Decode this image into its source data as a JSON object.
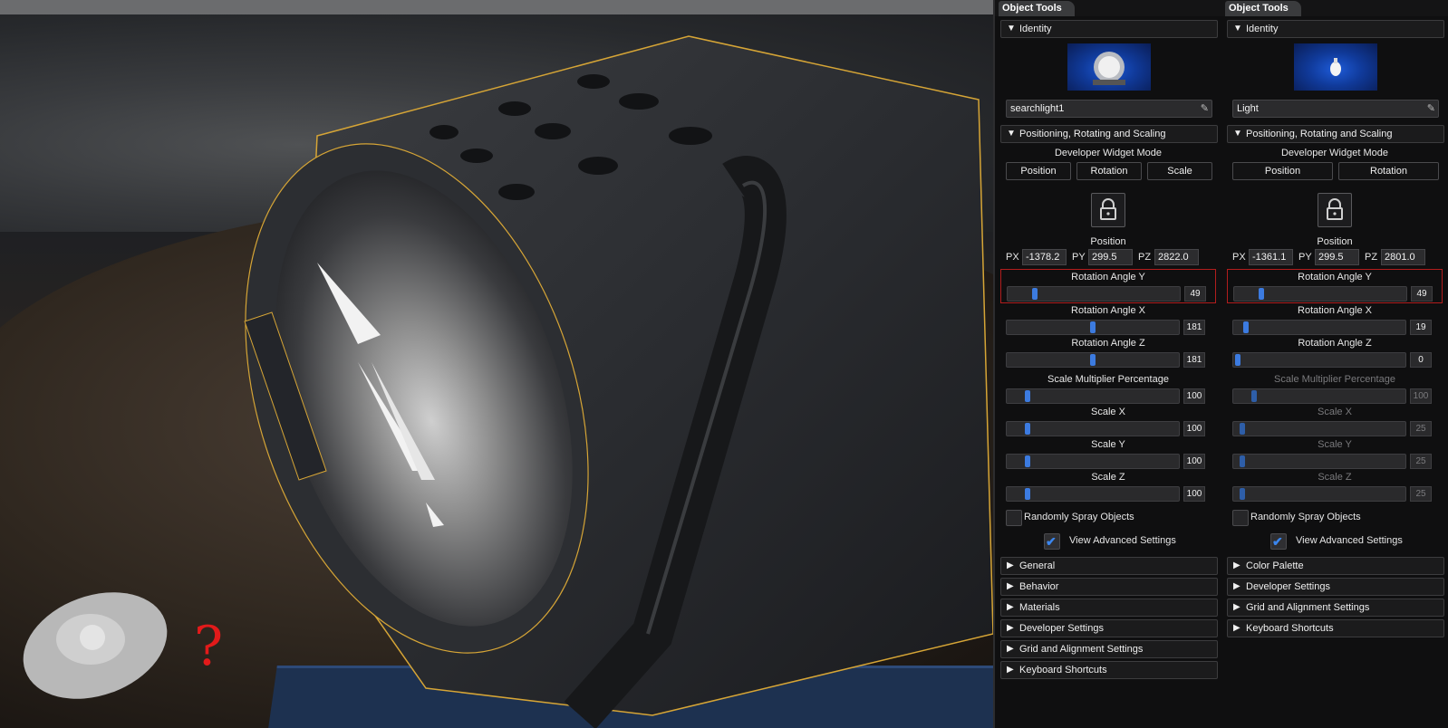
{
  "viewport": {
    "help_mark": "?"
  },
  "colors": {
    "accent": "#3c7be0",
    "highlight_border": "#b21d1d",
    "selection_outline": "#d6a536"
  },
  "panels": [
    {
      "tab": "Object Tools",
      "identity_header": "Identity",
      "thumbnail_icon": "searchlight-icon",
      "object_name": "searchlight1",
      "positioning_header": "Positioning, Rotating and Scaling",
      "widget_mode_label": "Developer Widget Mode",
      "mode_buttons": [
        "Position",
        "Rotation",
        "Scale"
      ],
      "position_label": "Position",
      "position": {
        "px_label": "PX",
        "px": "-1378.2",
        "py_label": "PY",
        "py": "299.5",
        "pz_label": "PZ",
        "pz": "2822.0"
      },
      "sliders": [
        {
          "label": "Rotation Angle Y",
          "value": "49",
          "level": 0.14,
          "highlight": true,
          "dim": false
        },
        {
          "label": "Rotation Angle X",
          "value": "181",
          "level": 0.5,
          "highlight": false,
          "dim": false
        },
        {
          "label": "Rotation Angle Z",
          "value": "181",
          "level": 0.5,
          "highlight": false,
          "dim": false
        },
        {
          "label": "Scale Multiplier Percentage",
          "value": "100",
          "level": 0.1,
          "highlight": false,
          "dim": false
        },
        {
          "label": "Scale X",
          "value": "100",
          "level": 0.1,
          "highlight": false,
          "dim": false
        },
        {
          "label": "Scale Y",
          "value": "100",
          "level": 0.1,
          "highlight": false,
          "dim": false
        },
        {
          "label": "Scale Z",
          "value": "100",
          "level": 0.1,
          "highlight": false,
          "dim": false
        }
      ],
      "checkboxes": [
        {
          "label": "Randomly Spray Objects",
          "checked": false
        },
        {
          "label": "View Advanced Settings",
          "checked": true
        }
      ],
      "collapsed_sections": [
        "General",
        "Behavior",
        "Materials",
        "Developer Settings",
        "Grid and Alignment Settings",
        "Keyboard Shortcuts"
      ]
    },
    {
      "tab": "Object Tools",
      "identity_header": "Identity",
      "thumbnail_icon": "lightbulb-icon",
      "object_name": "Light",
      "positioning_header": "Positioning, Rotating and Scaling",
      "widget_mode_label": "Developer Widget Mode",
      "mode_buttons": [
        "Position",
        "Rotation"
      ],
      "position_label": "Position",
      "position": {
        "px_label": "PX",
        "px": "-1361.1",
        "py_label": "PY",
        "py": "299.5",
        "pz_label": "PZ",
        "pz": "2801.0"
      },
      "sliders": [
        {
          "label": "Rotation Angle Y",
          "value": "49",
          "level": 0.14,
          "highlight": true,
          "dim": false
        },
        {
          "label": "Rotation Angle X",
          "value": "19",
          "level": 0.05,
          "highlight": false,
          "dim": false
        },
        {
          "label": "Rotation Angle Z",
          "value": "0",
          "level": 0.0,
          "highlight": false,
          "dim": false
        },
        {
          "label": "Scale Multiplier Percentage",
          "value": "100",
          "level": 0.1,
          "highlight": false,
          "dim": true
        },
        {
          "label": "Scale X",
          "value": "25",
          "level": 0.03,
          "highlight": false,
          "dim": true
        },
        {
          "label": "Scale Y",
          "value": "25",
          "level": 0.03,
          "highlight": false,
          "dim": true
        },
        {
          "label": "Scale Z",
          "value": "25",
          "level": 0.03,
          "highlight": false,
          "dim": true
        }
      ],
      "checkboxes": [
        {
          "label": "Randomly Spray Objects",
          "checked": false
        },
        {
          "label": "View Advanced Settings",
          "checked": true
        }
      ],
      "collapsed_sections": [
        "Color Palette",
        "Developer Settings",
        "Grid and Alignment Settings",
        "Keyboard Shortcuts"
      ]
    }
  ]
}
